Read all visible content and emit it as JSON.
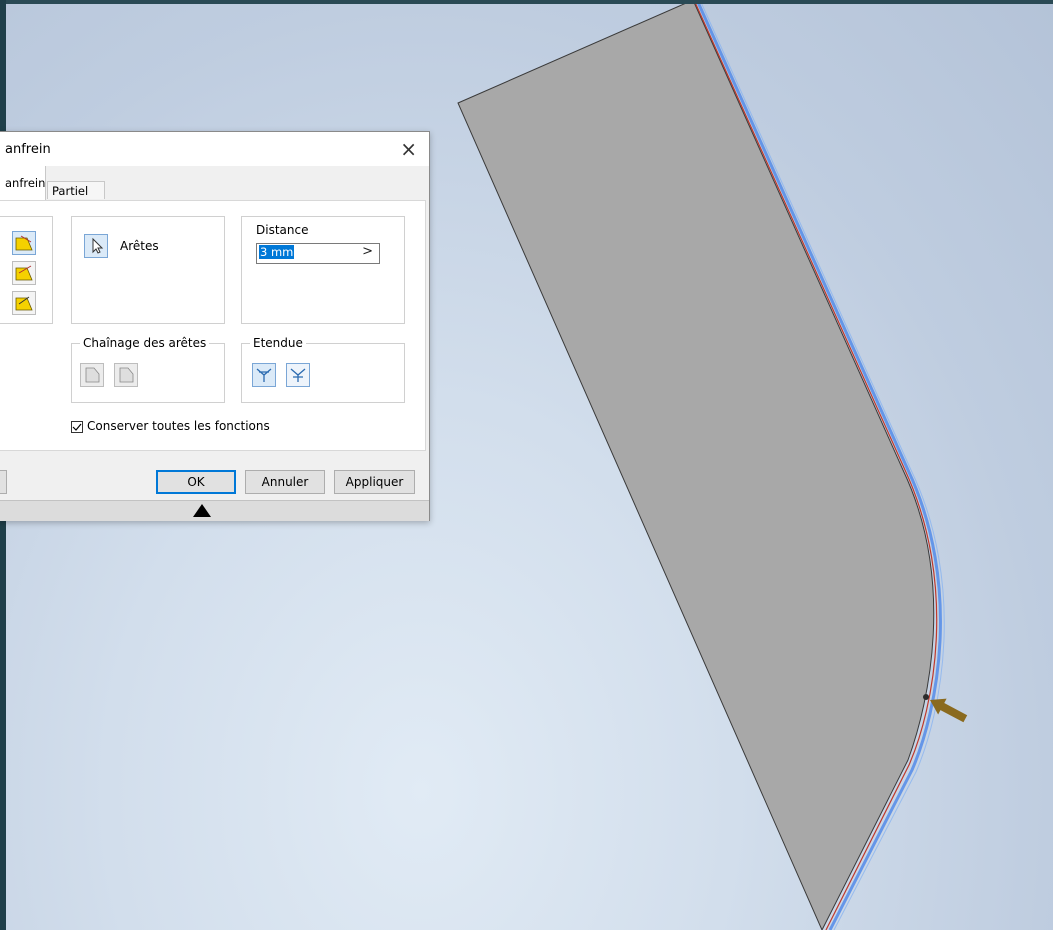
{
  "dialog": {
    "title": "anfrein",
    "close_symbol": "×",
    "tabs": [
      {
        "label": "anfrein"
      },
      {
        "label": "Partiel"
      }
    ],
    "edges_label": "Arêtes",
    "distance": {
      "label": "Distance",
      "value": "3 mm",
      "arrow_symbol": ">"
    },
    "edge_chain_label": "Chaînage des arêtes",
    "extent_label": "Etendue",
    "preserve_features_label": "Conserver toutes les fonctions",
    "preserve_features_checked": true,
    "buttons": {
      "ok": "OK",
      "cancel": "Annuler",
      "apply": "Appliquer"
    },
    "icons": [
      "chamfer-distance-icon",
      "chamfer-distance-angle-icon",
      "chamfer-two-distances-icon",
      "select-cursor-icon",
      "chain-all-edges-icon",
      "chain-single-edge-icon",
      "extent-all-icon",
      "extent-partial-icon",
      "expand-triangle-icon"
    ]
  },
  "viewport": {
    "background_colors": [
      "#b4c3d8",
      "#e1ebf5"
    ],
    "part_color": "#a8a8a8",
    "highlight_edge_color": "#5a8fe8",
    "selected_edge_color": "#c0392b",
    "direction_arrow_color": "#8a6a1f"
  }
}
